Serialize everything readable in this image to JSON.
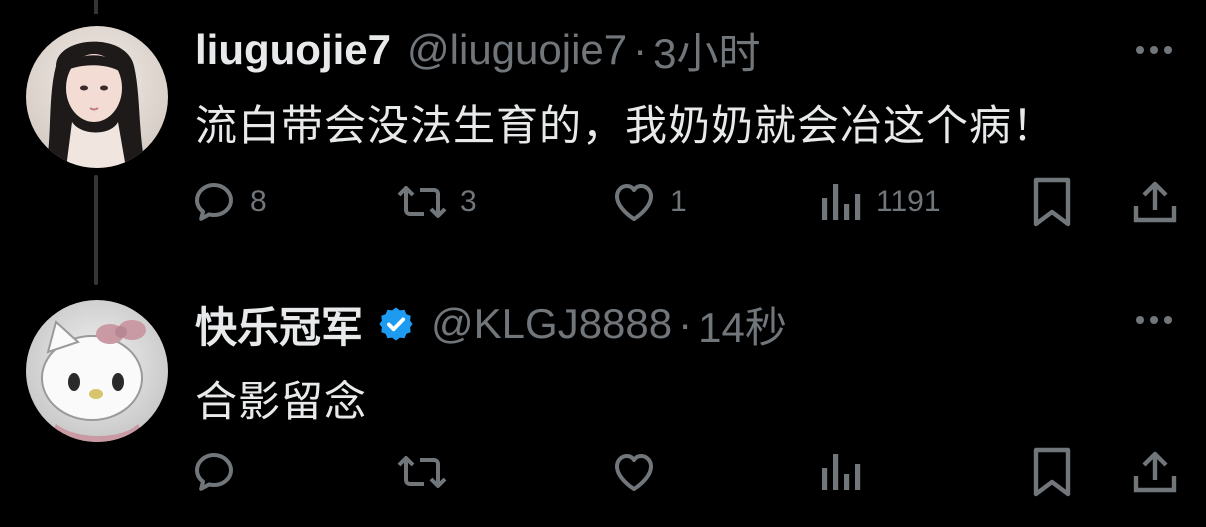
{
  "tweets": [
    {
      "display_name": "liuguojie7",
      "handle": "@liuguojie7",
      "separator": "·",
      "time": "3小时",
      "verified": false,
      "text": "流白带会没法生育的，我奶奶就会冶这个病！",
      "counts": {
        "reply": "8",
        "retweet": "3",
        "like": "1",
        "views": "1191"
      }
    },
    {
      "display_name": "快乐冠军",
      "handle": "@KLGJ8888",
      "separator": "·",
      "time": "14秒",
      "verified": true,
      "text": "合影留念",
      "counts": {
        "reply": "",
        "retweet": "",
        "like": "",
        "views": ""
      }
    }
  ],
  "colors": {
    "background": "#000000",
    "primary_text": "#e7e9ea",
    "secondary_text": "#71767b",
    "verified_blue": "#1d9bf0",
    "thread_line": "#333639"
  },
  "icons": {
    "reply": "reply-bubble-icon",
    "retweet": "retweet-icon",
    "like": "heart-icon",
    "views": "analytics-bars-icon",
    "bookmark": "bookmark-icon",
    "share": "share-upload-icon",
    "more": "more-dots-icon",
    "verified": "verified-badge-icon"
  }
}
